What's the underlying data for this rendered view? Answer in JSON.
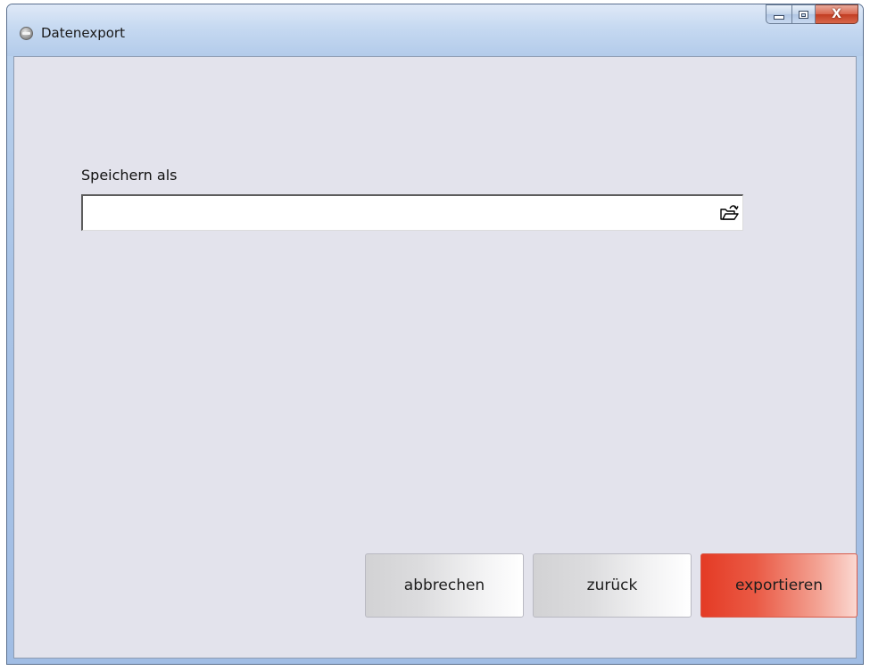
{
  "window": {
    "title": "Datenexport",
    "app_icon": "app-disc-icon",
    "caption_buttons": {
      "minimize_icon": "minimize-icon",
      "maximize_icon": "maximize-icon",
      "close_icon": "close-icon",
      "close_glyph": "X"
    }
  },
  "form": {
    "save_as_label": "Speichern als",
    "path_value": "",
    "browse_icon": "open-folder-icon"
  },
  "buttons": {
    "cancel_label": "abbrechen",
    "back_label": "zurück",
    "export_label": "exportieren"
  },
  "colors": {
    "client_background": "#e3e3ec",
    "export_accent": "#e43b25",
    "close_button": "#c23d22"
  }
}
